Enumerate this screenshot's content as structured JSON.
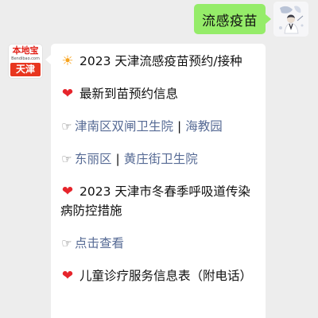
{
  "sent_message": {
    "text": "流感疫苗"
  },
  "brand_avatar": {
    "top_text": "本地宝",
    "url_text": "Bendibao.com",
    "city_text": "天津"
  },
  "reply": {
    "title": {
      "icon": "sun-icon",
      "glyph": "☀",
      "text": "2023 天津流感疫苗预约/接种"
    },
    "section1": {
      "icon": "heart-icon",
      "glyph": "❤",
      "text": "最新到苗预约信息"
    },
    "link_row1": {
      "icon": "pointing-hand-icon",
      "glyph": "☞",
      "link_a": "津南区双闸卫生院",
      "separator": "|",
      "link_b": "海教园"
    },
    "link_row2": {
      "icon": "pointing-hand-icon",
      "glyph": "☞",
      "link_a": "东丽区",
      "separator": "|",
      "link_b": "黄庄街卫生院"
    },
    "section2": {
      "icon": "heart-icon",
      "glyph": "❤",
      "text": "2023 天津市冬春季呼吸道传染病防控措施"
    },
    "link_row3": {
      "icon": "pointing-hand-icon",
      "glyph": "☞",
      "link_a": "点击查看"
    },
    "section3": {
      "icon": "heart-icon",
      "glyph": "❤",
      "text": "儿童诊疗服务信息表（附电话）"
    }
  },
  "colors": {
    "background": "#ededed",
    "sent_bubble": "#95ec69",
    "received_bubble": "#ffffff",
    "link": "#576b95",
    "heart": "#e6242b",
    "sun": "#f7a21b",
    "brand_red": "#e8361f"
  }
}
